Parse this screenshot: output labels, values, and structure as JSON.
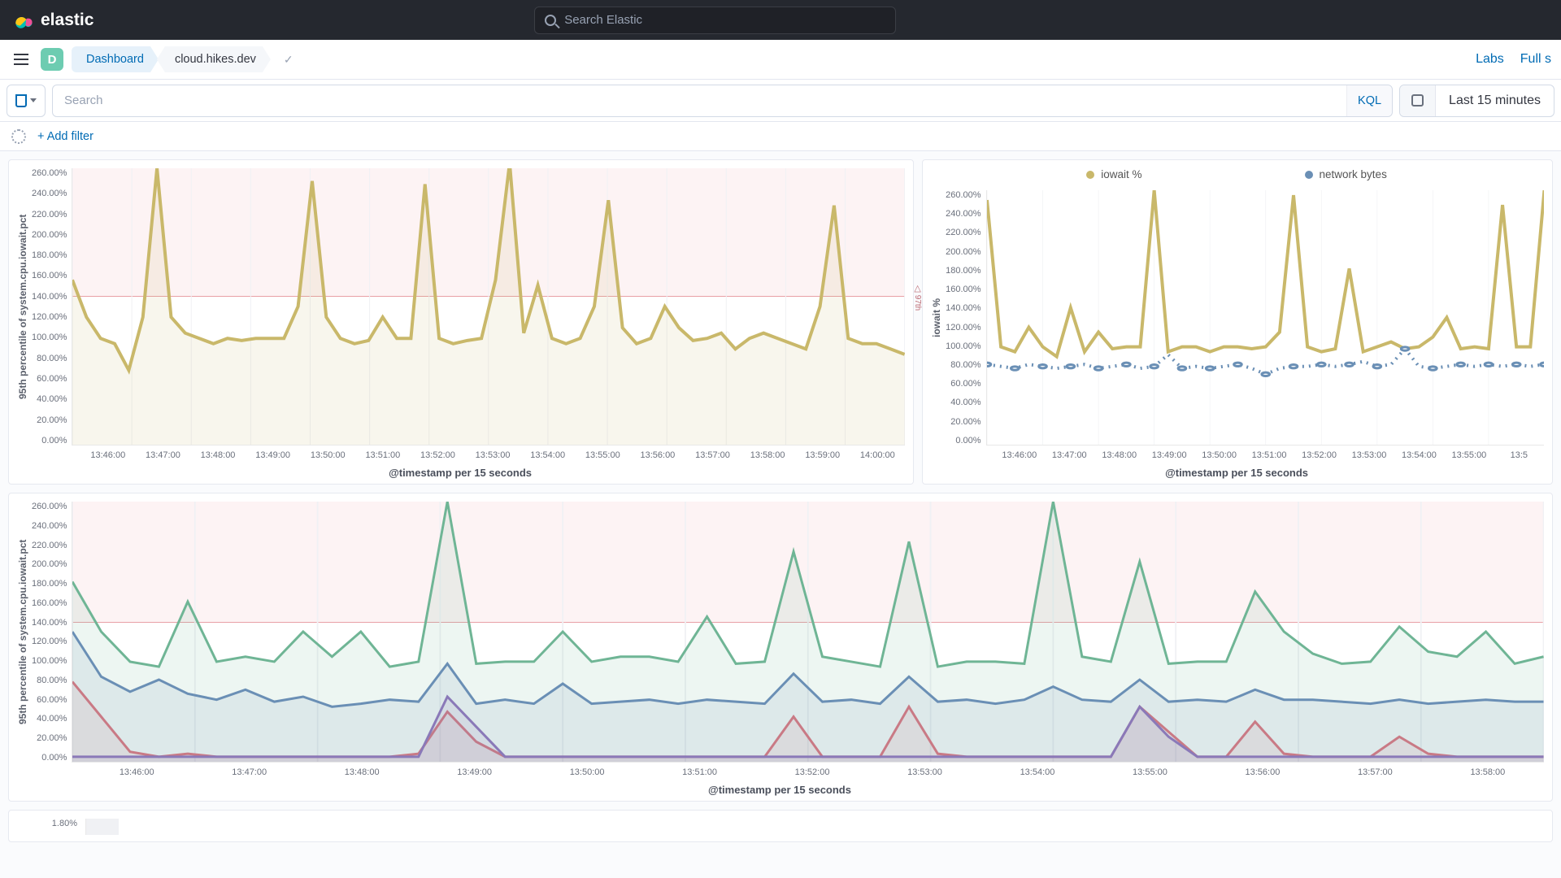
{
  "header": {
    "brand": "elastic",
    "search_placeholder": "Search Elastic"
  },
  "subheader": {
    "space_letter": "D",
    "crumb1": "Dashboard",
    "crumb2": "cloud.hikes.dev",
    "labs": "Labs",
    "full": "Full s"
  },
  "querybar": {
    "placeholder": "Search",
    "kql": "KQL",
    "timerange": "Last 15 minutes"
  },
  "filterbar": {
    "add": "+ Add filter"
  },
  "chart_data": [
    {
      "id": "panel1",
      "type": "line",
      "xlabel": "@timestamp per 15 seconds",
      "ylabel": "95th percentile of system.cpu.iowait.pct",
      "ylim": [
        0,
        260
      ],
      "y_ticks": [
        "260.00%",
        "240.00%",
        "220.00%",
        "200.00%",
        "180.00%",
        "160.00%",
        "140.00%",
        "120.00%",
        "100.00%",
        "80.00%",
        "60.00%",
        "40.00%",
        "20.00%",
        "0.00%"
      ],
      "categories": [
        "13:46:00",
        "13:47:00",
        "13:48:00",
        "13:49:00",
        "13:50:00",
        "13:51:00",
        "13:52:00",
        "13:53:00",
        "13:54:00",
        "13:55:00",
        "13:56:00",
        "13:57:00",
        "13:58:00",
        "13:59:00",
        "14:00:00"
      ],
      "threshold": {
        "value": 140,
        "label": "97th"
      },
      "series": [
        {
          "name": "iowait %",
          "color": "#c9b86a",
          "values": [
            155,
            120,
            100,
            95,
            70,
            120,
            260,
            120,
            105,
            100,
            95,
            100,
            98,
            100,
            100,
            100,
            130,
            248,
            120,
            100,
            95,
            98,
            120,
            100,
            100,
            245,
            100,
            95,
            98,
            100,
            155,
            265,
            105,
            150,
            100,
            95,
            100,
            130,
            230,
            110,
            95,
            100,
            130,
            110,
            98,
            100,
            105,
            90,
            100,
            105,
            100,
            95,
            90,
            130,
            225,
            100,
            95,
            95,
            90,
            85
          ]
        }
      ]
    },
    {
      "id": "panel2",
      "type": "line",
      "xlabel": "@timestamp per 15 seconds",
      "ylabel": "iowait %",
      "ylim": [
        0,
        260
      ],
      "y_ticks": [
        "260.00%",
        "240.00%",
        "220.00%",
        "200.00%",
        "180.00%",
        "160.00%",
        "140.00%",
        "120.00%",
        "100.00%",
        "80.00%",
        "60.00%",
        "40.00%",
        "20.00%",
        "0.00%"
      ],
      "categories": [
        "13:46:00",
        "13:47:00",
        "13:48:00",
        "13:49:00",
        "13:50:00",
        "13:51:00",
        "13:52:00",
        "13:53:00",
        "13:54:00",
        "13:55:00",
        "13:5"
      ],
      "legend": [
        {
          "name": "iowait %",
          "color": "#c9b86a"
        },
        {
          "name": "network bytes",
          "color": "#6a8fb5"
        }
      ],
      "series": [
        {
          "name": "iowait %",
          "color": "#c9b86a",
          "values": [
            250,
            100,
            95,
            120,
            100,
            90,
            140,
            95,
            115,
            98,
            100,
            100,
            260,
            95,
            100,
            100,
            95,
            100,
            100,
            98,
            100,
            115,
            255,
            100,
            95,
            98,
            180,
            95,
            100,
            105,
            98,
            100,
            110,
            130,
            98,
            100,
            98,
            245,
            100,
            100,
            260
          ]
        },
        {
          "name": "network bytes",
          "color": "#6a8fb5",
          "marker": true,
          "values": [
            82,
            80,
            78,
            82,
            80,
            78,
            80,
            82,
            78,
            80,
            82,
            78,
            80,
            92,
            78,
            80,
            78,
            80,
            82,
            78,
            72,
            78,
            80,
            80,
            82,
            80,
            82,
            85,
            80,
            82,
            98,
            80,
            78,
            80,
            82,
            80,
            82,
            80,
            82,
            80,
            82
          ]
        }
      ]
    },
    {
      "id": "panel3",
      "type": "line",
      "xlabel": "@timestamp per 15 seconds",
      "ylabel": "95th percentile of system.cpu.iowait.pct",
      "ylim": [
        0,
        260
      ],
      "y_ticks": [
        "260.00%",
        "240.00%",
        "220.00%",
        "200.00%",
        "180.00%",
        "160.00%",
        "140.00%",
        "120.00%",
        "100.00%",
        "80.00%",
        "60.00%",
        "40.00%",
        "20.00%",
        "0.00%"
      ],
      "categories": [
        "13:46:00",
        "13:47:00",
        "13:48:00",
        "13:49:00",
        "13:50:00",
        "13:51:00",
        "13:52:00",
        "13:53:00",
        "13:54:00",
        "13:55:00",
        "13:56:00",
        "13:57:00",
        "13:58:00"
      ],
      "threshold": {
        "value": 140,
        "label": ""
      },
      "series": [
        {
          "name": "green",
          "color": "#6fb595",
          "values": [
            180,
            130,
            100,
            95,
            160,
            100,
            105,
            100,
            130,
            105,
            130,
            95,
            100,
            260,
            98,
            100,
            100,
            130,
            100,
            105,
            105,
            100,
            145,
            98,
            100,
            210,
            105,
            100,
            95,
            220,
            95,
            100,
            100,
            98,
            260,
            105,
            100,
            200,
            98,
            100,
            100,
            170,
            130,
            108,
            98,
            100,
            135,
            110,
            105,
            130,
            98,
            105
          ]
        },
        {
          "name": "blue",
          "color": "#6a8fb5",
          "values": [
            130,
            85,
            70,
            82,
            68,
            62,
            72,
            60,
            65,
            55,
            58,
            62,
            60,
            98,
            58,
            62,
            58,
            78,
            58,
            60,
            62,
            58,
            62,
            60,
            58,
            88,
            60,
            62,
            58,
            85,
            60,
            62,
            58,
            62,
            75,
            62,
            60,
            82,
            60,
            62,
            60,
            72,
            62,
            62,
            60,
            58,
            62,
            58,
            60,
            62,
            60,
            60
          ]
        },
        {
          "name": "red",
          "color": "#c97a85",
          "values": [
            80,
            45,
            10,
            5,
            8,
            5,
            5,
            5,
            5,
            5,
            5,
            5,
            8,
            50,
            20,
            5,
            5,
            5,
            5,
            5,
            5,
            5,
            5,
            5,
            5,
            45,
            5,
            5,
            5,
            55,
            8,
            5,
            5,
            5,
            5,
            5,
            5,
            55,
            30,
            5,
            5,
            40,
            8,
            5,
            5,
            5,
            25,
            8,
            5,
            5,
            5,
            5
          ]
        },
        {
          "name": "purple",
          "color": "#8a79b8",
          "values": [
            5,
            5,
            5,
            5,
            5,
            5,
            5,
            5,
            5,
            5,
            5,
            5,
            5,
            65,
            35,
            5,
            5,
            5,
            5,
            5,
            5,
            5,
            5,
            5,
            5,
            5,
            5,
            5,
            5,
            5,
            5,
            5,
            5,
            5,
            5,
            5,
            5,
            55,
            25,
            5,
            5,
            5,
            5,
            5,
            5,
            5,
            5,
            5,
            5,
            5,
            5,
            5
          ]
        }
      ]
    }
  ],
  "panel4_tick": "1.80%"
}
